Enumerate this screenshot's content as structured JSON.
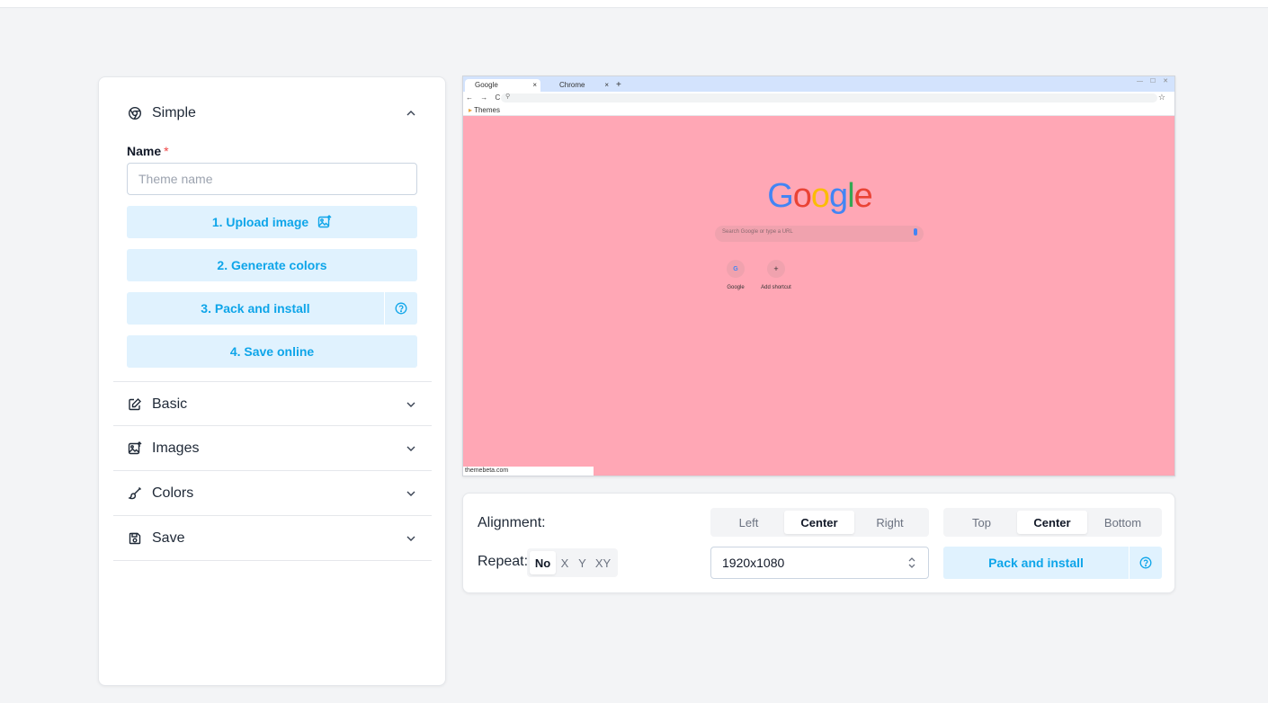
{
  "sidebar": {
    "simple": {
      "title": "Simple",
      "name_label": "Name",
      "required_mark": "*",
      "name_placeholder": "Theme name",
      "name_value": "",
      "steps": {
        "upload": "1. Upload image",
        "generate": "2. Generate colors",
        "pack": "3. Pack and install",
        "save": "4. Save online"
      }
    },
    "sections": {
      "basic": "Basic",
      "images": "Images",
      "colors": "Colors",
      "save": "Save"
    }
  },
  "preview": {
    "background_color": "#ffa7b5",
    "tabs": [
      "Google",
      "Chrome"
    ],
    "tab_close": "×",
    "new_tab": "+",
    "window_controls": "— ☐ ✕",
    "nav_glyphs": "← → C",
    "bookmark": "Themes",
    "search_placeholder": "Search Google or type a URL",
    "shortcuts": [
      "Google",
      "Add shortcut"
    ],
    "status_text": "themebeta.com",
    "logo_letters": [
      "G",
      "o",
      "o",
      "g",
      "l",
      "e"
    ],
    "logo_colors": [
      "#4285f4",
      "#ea4335",
      "#fbbc05",
      "#4285f4",
      "#34a853",
      "#ea4335"
    ]
  },
  "options": {
    "alignment_label": "Alignment:",
    "alignment_h": [
      "Left",
      "Center",
      "Right"
    ],
    "alignment_h_selected": "Center",
    "alignment_v": [
      "Top",
      "Center",
      "Bottom"
    ],
    "alignment_v_selected": "Center",
    "repeat_label": "Repeat:",
    "repeat": [
      "No",
      "X",
      "Y",
      "XY"
    ],
    "repeat_selected": "No",
    "resolution": "1920x1080",
    "pack_button": "Pack and install"
  },
  "colors": {
    "accent": "#0ea5e9",
    "accent_bg": "#e0f2fe",
    "required": "#ef4444"
  }
}
